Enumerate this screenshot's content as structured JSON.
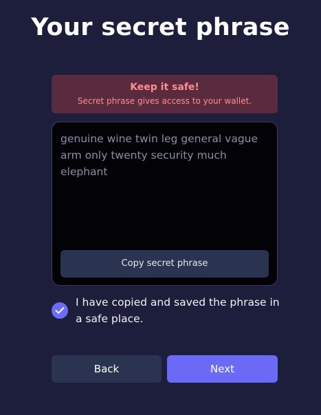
{
  "page": {
    "title": "Your secret phrase"
  },
  "warning": {
    "title": "Keep it safe!",
    "text": "Secret phrase gives access to your wallet."
  },
  "phrase": {
    "text": "genuine wine twin leg general vague arm only twenty security much elephant",
    "copy_label": "Copy secret phrase"
  },
  "confirm": {
    "checked": true,
    "label": "I have copied and saved the phrase in a safe place."
  },
  "actions": {
    "back_label": "Back",
    "next_label": "Next"
  },
  "colors": {
    "background": "#1c1e3b",
    "accent": "#6a6af6",
    "warning_bg": "#5a2a3f",
    "warning_text": "#ff8f8f",
    "secondary_button": "#2a3350"
  },
  "icons": {
    "checkbox": "checkmark-icon"
  }
}
